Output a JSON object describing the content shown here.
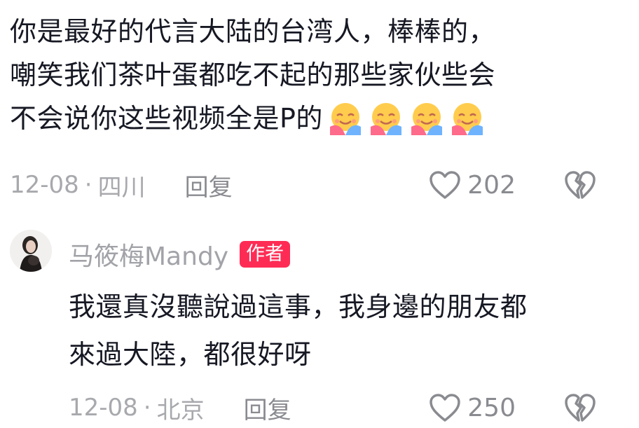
{
  "comment1": {
    "lines": [
      "你是最好的代言大陆的台湾人，棒棒的，",
      "嘲笑我们茶叶蛋都吃不起的那些家伙些会",
      "不会说你这些视频全是P的"
    ],
    "emoji": "hug-face-emoji",
    "emoji_count": 4,
    "date": "12-08",
    "separator": "·",
    "location": "四川",
    "reply_label": "回复",
    "likes": "202"
  },
  "comment2": {
    "author": "马筱梅Mandy",
    "badge": "作者",
    "lines": [
      "我還真沒聽說過這事，我身邊的朋友都",
      "來過大陸，都很好呀"
    ],
    "date": "12-08",
    "separator": "·",
    "location": "北京",
    "reply_label": "回复",
    "likes": "250"
  },
  "icons": {
    "like": "heart-outline-icon",
    "dislike": "broken-heart-icon"
  },
  "colors": {
    "text": "#161823",
    "meta": "#a8a9ad",
    "badge": "#fe2c55"
  }
}
